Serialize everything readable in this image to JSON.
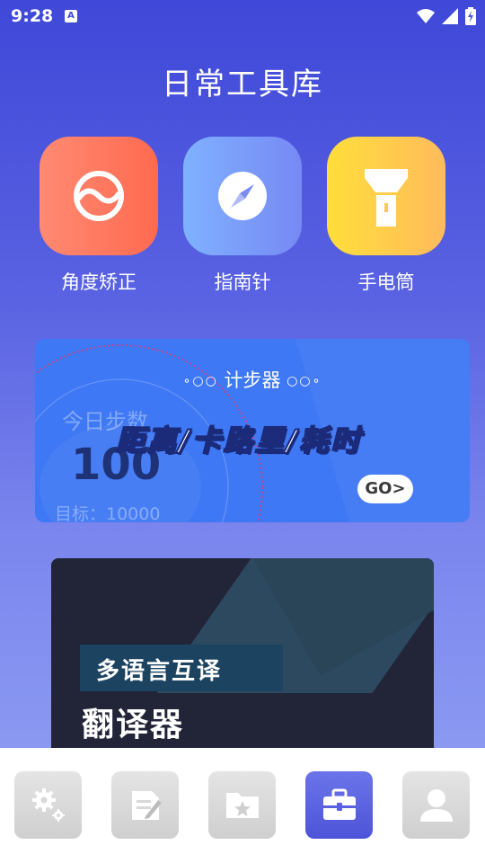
{
  "status_bar": {
    "time": "9:28",
    "notification_glyph": "A"
  },
  "app_title": "日常工具库",
  "tools": [
    {
      "label": "角度矫正",
      "icon": "level-icon",
      "color": "#ff7a5e"
    },
    {
      "label": "指南针",
      "icon": "compass-icon",
      "color": "#7a9ff8"
    },
    {
      "label": "手电筒",
      "icon": "flashlight-icon",
      "color": "#ffd04a"
    }
  ],
  "pedometer": {
    "title": "计步器",
    "today_label": "今日步数",
    "metrics_label": "距离/卡路里/耗时",
    "step_count": "100",
    "goal_label": "目标：10000",
    "go_label": "GO>"
  },
  "translator": {
    "subtitle": "多语言互译",
    "title": "翻译器"
  },
  "bottom_nav": [
    {
      "name": "settings",
      "icon": "gear-icon",
      "active": false
    },
    {
      "name": "notes",
      "icon": "note-icon",
      "active": false
    },
    {
      "name": "favorites",
      "icon": "folder-star-icon",
      "active": false
    },
    {
      "name": "tools",
      "icon": "toolbox-icon",
      "active": true
    },
    {
      "name": "profile",
      "icon": "user-icon",
      "active": false
    }
  ],
  "colors": {
    "accent": "#5058dc",
    "card_blue": "#3f78f4",
    "card_dark": "#222438"
  }
}
